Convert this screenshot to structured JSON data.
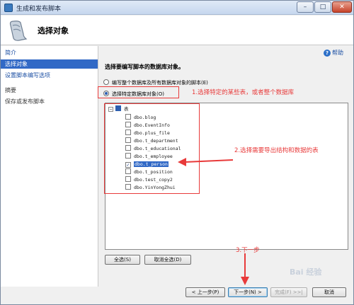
{
  "window": {
    "title": "生成和发布脚本",
    "controls": {
      "minimize": "–",
      "maximize": "□",
      "close": "✕"
    }
  },
  "header": {
    "title": "选择对象"
  },
  "sidebar": {
    "items": [
      {
        "label": "简介",
        "state": "link"
      },
      {
        "label": "选择对象",
        "state": "selected"
      },
      {
        "label": "设置脚本编写选项",
        "state": "link"
      },
      {
        "label": "摘要",
        "state": "normal"
      },
      {
        "label": "保存或发布脚本",
        "state": "normal"
      }
    ]
  },
  "main": {
    "help_label": "帮助",
    "section_title": "选择要编写脚本的数据库对象。",
    "radio_all_label": "编写整个数据库及所有数据库对象的脚本(E)",
    "radio_specific_label": "选择特定数据库对象(O)",
    "tree": {
      "root_label": "表",
      "items": [
        {
          "label": "dbo.blog",
          "checked": false
        },
        {
          "label": "dbo.EventInfo",
          "checked": false
        },
        {
          "label": "dbo.plus_file",
          "checked": false
        },
        {
          "label": "dbo.t_department",
          "checked": false
        },
        {
          "label": "dbo.t_educational",
          "checked": false
        },
        {
          "label": "dbo.t_employee",
          "checked": false
        },
        {
          "label": "dbo.t_person",
          "checked": true
        },
        {
          "label": "dbo.t_position",
          "checked": false
        },
        {
          "label": "dbo.test_copy2",
          "checked": false
        },
        {
          "label": "dbo.YinYongZhui",
          "checked": false
        }
      ]
    },
    "select_all_label": "全选(S)",
    "deselect_all_label": "取消全选(D)"
  },
  "footer": {
    "prev_label": "< 上一步(P)",
    "next_label": "下一步(N) >",
    "finish_label": "完成(F) >>|",
    "cancel_label": "取消"
  },
  "annotations": {
    "note1": "1.选择特定的某些表，或者整个数据库",
    "note2": "2.选择需要导出结构和数据的表",
    "note3": "3.下一步"
  },
  "watermark": "Bai 经验",
  "colors": {
    "annotation": "#e83a3a",
    "selection": "#3169c6",
    "link": "#1b4fa3"
  }
}
